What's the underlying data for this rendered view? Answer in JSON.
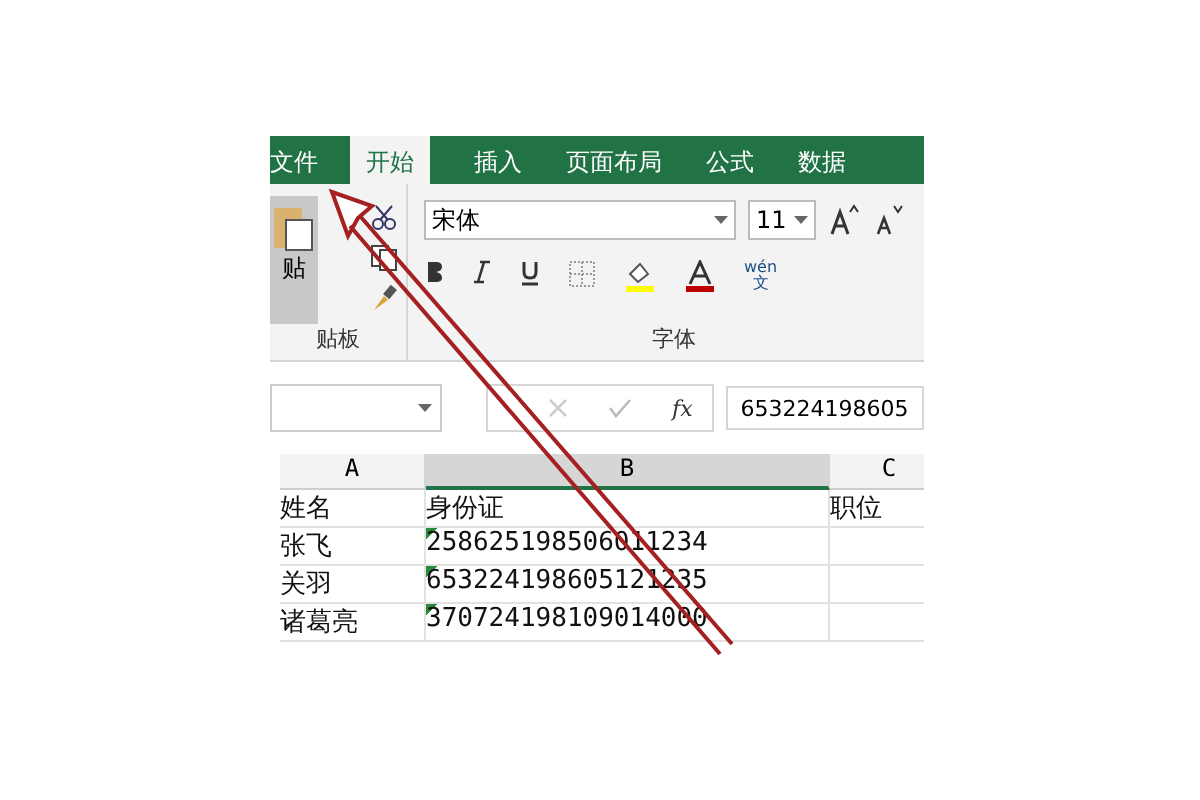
{
  "tabs": [
    {
      "label": "文件",
      "selected": false
    },
    {
      "label": "开始",
      "selected": true
    },
    {
      "label": "插入",
      "selected": false
    },
    {
      "label": "页面布局",
      "selected": false
    },
    {
      "label": "公式",
      "selected": false
    },
    {
      "label": "数据",
      "selected": false
    }
  ],
  "clipboard": {
    "paste_label": "贴",
    "group_label": "贴板"
  },
  "font": {
    "name": "宋体",
    "size": "11",
    "group_label": "字体",
    "phonetic_top": "wén",
    "phonetic_bottom": "文"
  },
  "formula_bar": {
    "fx": "fx",
    "value": "653224198605"
  },
  "sheet": {
    "columns": [
      {
        "label": "A",
        "selected": false
      },
      {
        "label": "B",
        "selected": true
      },
      {
        "label": "C",
        "selected": false
      }
    ],
    "rows": [
      [
        "姓名",
        "身份证",
        "职位"
      ],
      [
        "张飞",
        "258625198506011234",
        ""
      ],
      [
        "关羽",
        "653224198605121235",
        ""
      ],
      [
        "诸葛亮",
        "370724198109014000",
        ""
      ]
    ]
  }
}
